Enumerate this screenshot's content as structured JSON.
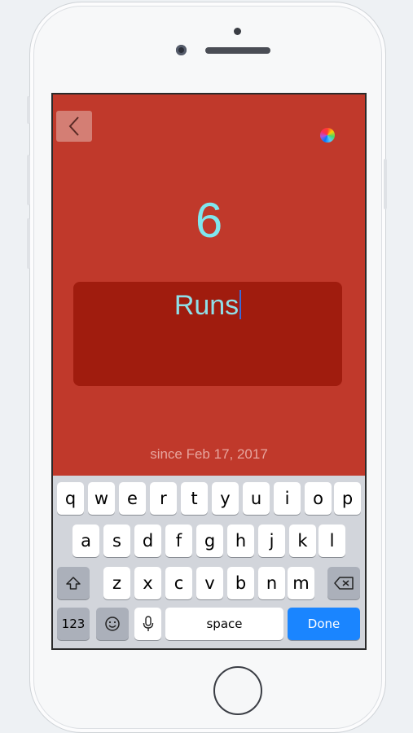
{
  "app": {
    "count": "6",
    "title_value": "Runs",
    "since_text": "since Feb 17, 2017",
    "icons": {
      "back": "chevron-left-icon",
      "color": "color-wheel-icon"
    },
    "colors": {
      "background": "#c0392b",
      "title_box": "#a01c0e",
      "count_text": "#7fe6ee"
    }
  },
  "keyboard": {
    "row1": [
      "q",
      "w",
      "e",
      "r",
      "t",
      "y",
      "u",
      "i",
      "o",
      "p"
    ],
    "row2": [
      "a",
      "s",
      "d",
      "f",
      "g",
      "h",
      "j",
      "k",
      "l"
    ],
    "row3": [
      "z",
      "x",
      "c",
      "v",
      "b",
      "n",
      "m"
    ],
    "numbers_key": "123",
    "space_key": "space",
    "done_key": "Done",
    "icons": {
      "shift": "shift-icon",
      "backspace": "backspace-icon",
      "emoji": "emoji-icon",
      "microphone": "microphone-icon"
    }
  }
}
